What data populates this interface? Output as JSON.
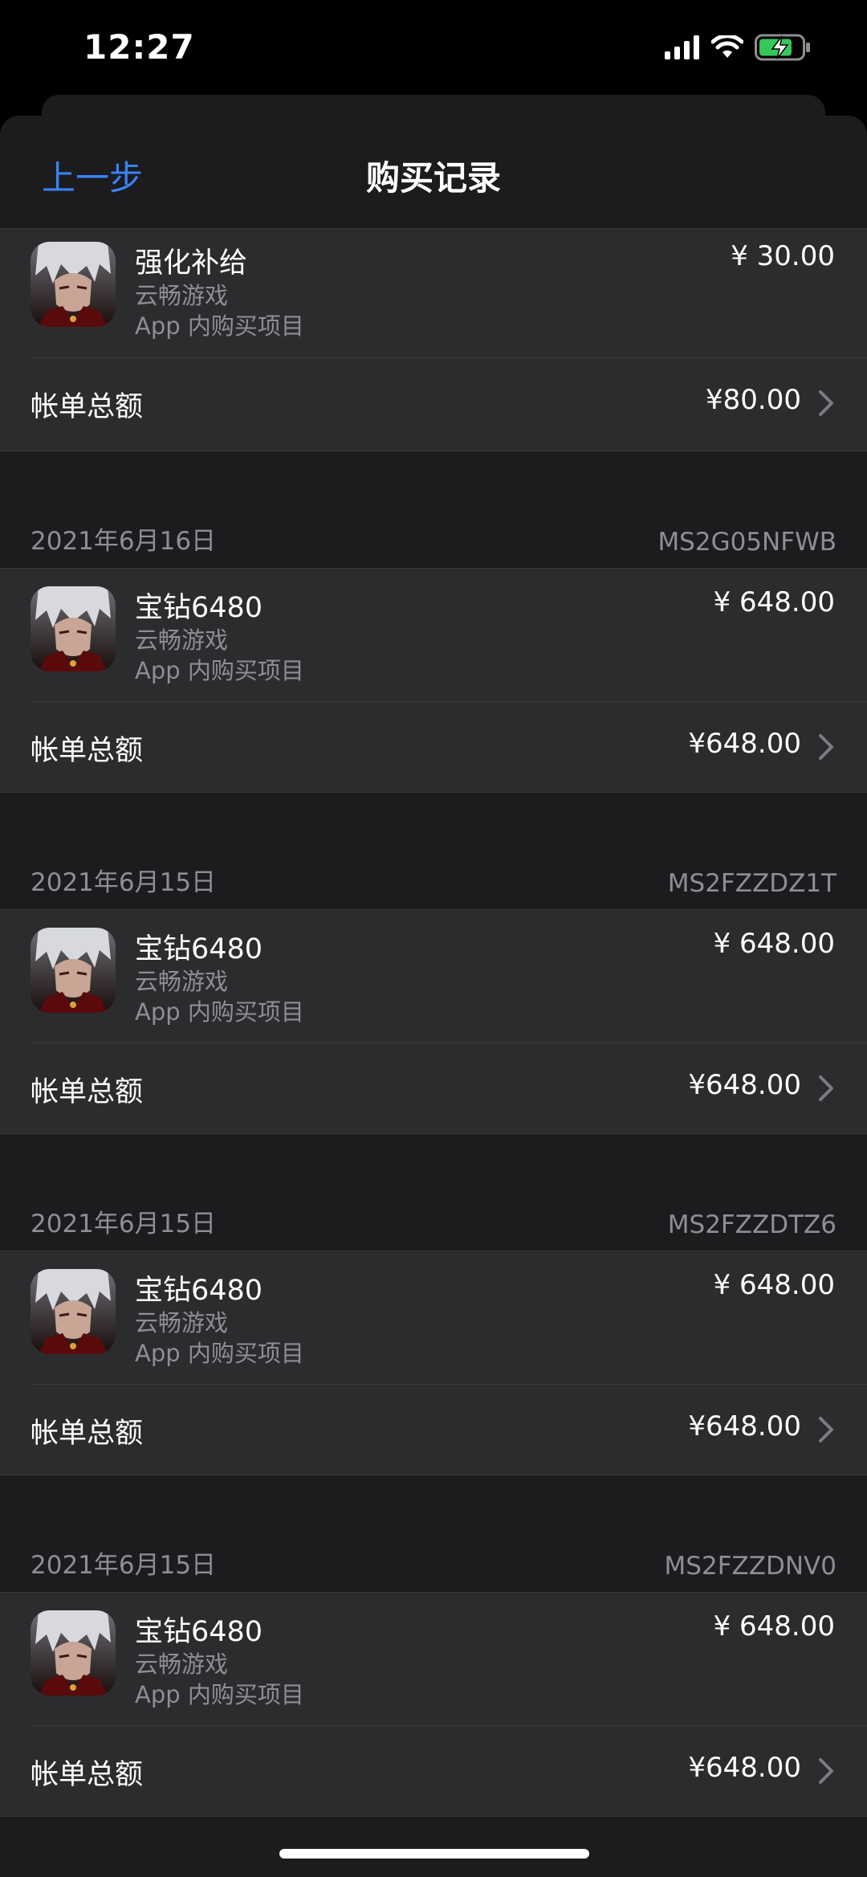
{
  "status": {
    "time": "12:27"
  },
  "nav": {
    "back": "上一步",
    "title": "购买记录"
  },
  "first_group": {
    "item": {
      "name": "强化补给",
      "developer": "云畅游戏",
      "type": "App 内购买项目",
      "price": "¥ 30.00"
    },
    "total_label": "帐单总额",
    "total": "¥80.00"
  },
  "purchases": [
    {
      "date": "2021年6月16日",
      "order": "MS2G05NFWB",
      "name": "宝钻6480",
      "developer": "云畅游戏",
      "type": "App 内购买项目",
      "price": "¥ 648.00",
      "total_label": "帐单总额",
      "total": "¥648.00"
    },
    {
      "date": "2021年6月15日",
      "order": "MS2FZZDZ1T",
      "name": "宝钻6480",
      "developer": "云畅游戏",
      "type": "App 内购买项目",
      "price": "¥ 648.00",
      "total_label": "帐单总额",
      "total": "¥648.00"
    },
    {
      "date": "2021年6月15日",
      "order": "MS2FZZDTZ6",
      "name": "宝钻6480",
      "developer": "云畅游戏",
      "type": "App 内购买项目",
      "price": "¥ 648.00",
      "total_label": "帐单总额",
      "total": "¥648.00"
    },
    {
      "date": "2021年6月15日",
      "order": "MS2FZZDNV0",
      "name": "宝钻6480",
      "developer": "云畅游戏",
      "type": "App 内购买项目",
      "price": "¥ 648.00",
      "total_label": "帐单总额",
      "total": "¥648.00"
    }
  ],
  "colors": {
    "accent": "#3a82f7",
    "sheet_bg": "#1c1c1e",
    "cell_bg": "#2c2c2e",
    "secondary_text": "#8e8e93"
  },
  "icons": [
    "signal-icon",
    "wifi-icon",
    "battery-charging-icon",
    "chevron-right-icon",
    "app-icon"
  ]
}
